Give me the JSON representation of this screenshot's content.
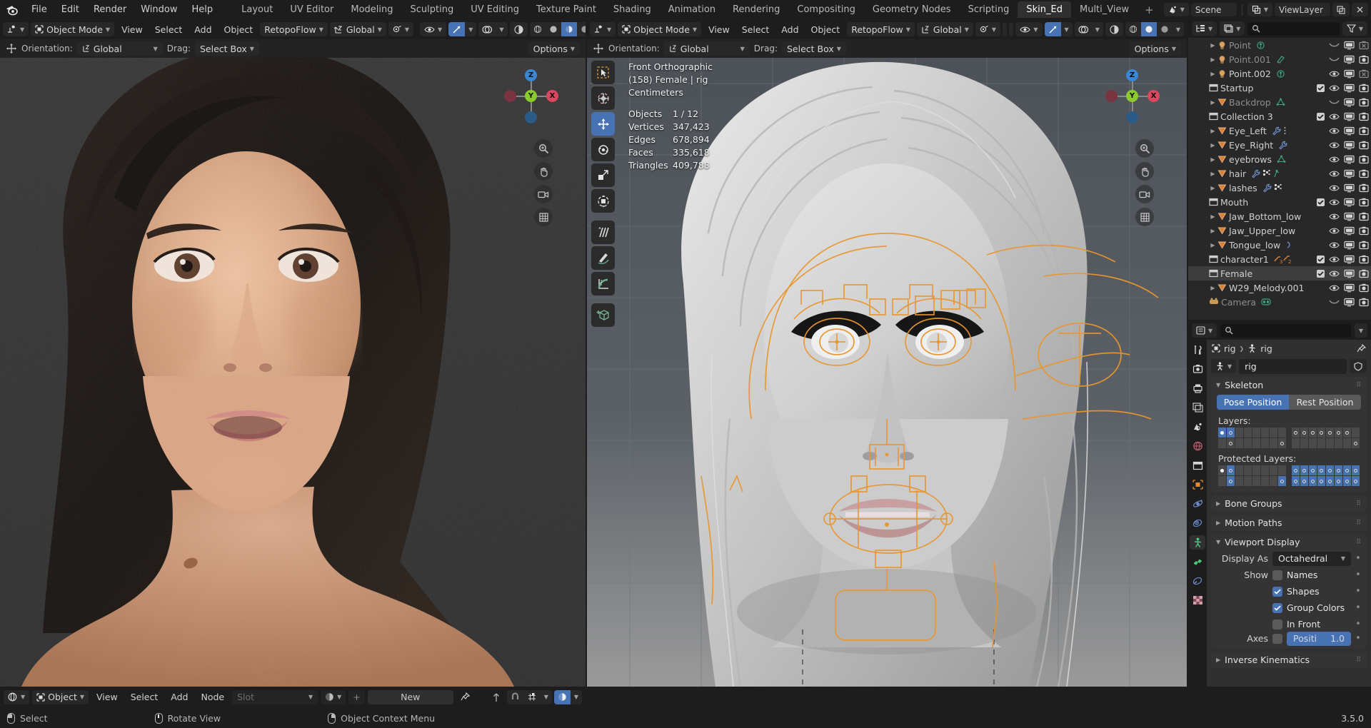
{
  "app": {
    "version": "3.5.0",
    "logo_icon": "blender-logo-icon"
  },
  "topbar": {
    "menus": [
      "File",
      "Edit",
      "Render",
      "Window",
      "Help"
    ],
    "workspace_tabs": [
      {
        "label": "Layout",
        "active": false
      },
      {
        "label": "UV Editor",
        "active": false
      },
      {
        "label": "Modeling",
        "active": false
      },
      {
        "label": "Sculpting",
        "active": false
      },
      {
        "label": "UV Editing",
        "active": false
      },
      {
        "label": "Texture Paint",
        "active": false
      },
      {
        "label": "Shading",
        "active": false
      },
      {
        "label": "Animation",
        "active": false
      },
      {
        "label": "Rendering",
        "active": false
      },
      {
        "label": "Compositing",
        "active": false
      },
      {
        "label": "Geometry Nodes",
        "active": false
      },
      {
        "label": "Scripting",
        "active": false
      },
      {
        "label": "Skin_Ed",
        "active": true
      },
      {
        "label": "Multi_View",
        "active": false
      }
    ],
    "add_workspace_label": "+",
    "scene_label": "Scene",
    "scene_icon": "scene-icon",
    "viewlayer_label": "ViewLayer",
    "viewlayer_icon": "viewlayer-icon",
    "new_viewlayer_icon": "copy-icon",
    "remove_viewlayer_icon": "x-icon"
  },
  "viewport1": {
    "editor_icon": "editor-type-icon",
    "mode_label": "Object Mode",
    "mode_icon": "object-mode-icon",
    "menus": [
      "View",
      "Select",
      "Add",
      "Object"
    ],
    "addon_menu": "RetopoFlow",
    "transform_orientation": "Global",
    "orientation_icon": "orientation-icon",
    "snap_icon": "magnet-icon",
    "snap_to_icon": "snap-increment-icon",
    "proportional_icon": "proportional-edit-icon",
    "falloff_icon": "falloff-smooth-icon",
    "visibility_icon": "eye-icon",
    "gizmo_icon": "gizmo-icon",
    "overlay_icon": "overlays-icon",
    "xray_icon": "xray-icon",
    "shading_icon": "shading-rendered-icon",
    "options_label": "Options",
    "subheader": {
      "orientation_label": "Orientation:",
      "orientation_value": "Global",
      "drag_label": "Drag:",
      "drag_value": "Select Box"
    }
  },
  "viewport2": {
    "editor_icon": "editor-type-icon",
    "mode_label": "Object Mode",
    "mode_icon": "object-mode-icon",
    "menus": [
      "View",
      "Select",
      "Add",
      "Object"
    ],
    "addon_menu": "RetopoFlow",
    "transform_orientation": "Global",
    "options_label": "Options",
    "subheader": {
      "orientation_label": "Orientation:",
      "orientation_value": "Global",
      "drag_label": "Drag:",
      "drag_value": "Select Box"
    },
    "gizmo": {
      "x": "X",
      "y": "Y",
      "z": "Z"
    },
    "toolbar": [
      {
        "name": "tweak-tool",
        "active": false
      },
      {
        "name": "cursor-tool",
        "active": false
      },
      {
        "name": "move-tool",
        "active": true
      },
      {
        "name": "rotate-tool",
        "active": false
      },
      {
        "name": "scale-tool",
        "active": false
      },
      {
        "name": "transform-tool",
        "active": false
      },
      {
        "name": "annotate-tool",
        "active": false
      },
      {
        "name": "annotate-line-tool",
        "active": false
      },
      {
        "name": "measure-tool",
        "active": false
      },
      {
        "name": "add-cube-tool",
        "active": false
      }
    ],
    "stats": {
      "view_name": "Front Orthographic",
      "object_line": "(158) Female | rig",
      "units": "Centimeters",
      "rows": [
        {
          "label": "Objects",
          "value": "1 / 12"
        },
        {
          "label": "Vertices",
          "value": "347,423"
        },
        {
          "label": "Edges",
          "value": "678,894"
        },
        {
          "label": "Faces",
          "value": "335,618"
        },
        {
          "label": "Triangles",
          "value": "409,788"
        }
      ]
    }
  },
  "outliner": {
    "display_mode_icon": "outliner-view-layer-icon",
    "filter_id_icon": "filter-id-icon",
    "search_placeholder": "",
    "search_icon": "search-icon",
    "filter_icon": "filter-funnel-icon",
    "rows": [
      {
        "name": "Point",
        "type": "light",
        "indent": 2,
        "dim": true,
        "disclosure": true,
        "data_icon": "light-point-icon",
        "checkbox": null,
        "eye": "closed",
        "screen": true,
        "camera": "disabled"
      },
      {
        "name": "Point.001",
        "type": "light",
        "indent": 2,
        "dim": true,
        "disclosure": true,
        "data_icon": "light-area-icon",
        "checkbox": null,
        "eye": "closed",
        "screen": true,
        "camera": "on"
      },
      {
        "name": "Point.002",
        "type": "light",
        "indent": 2,
        "dim": false,
        "disclosure": true,
        "data_icon": "light-point-icon",
        "checkbox": null,
        "eye": "open",
        "screen": true,
        "camera": "disabled"
      },
      {
        "name": "Startup",
        "type": "collection",
        "indent": 1,
        "dim": false,
        "disclosure": false,
        "data_icon": null,
        "checkbox": true,
        "eye": "open",
        "screen": true,
        "camera": "on"
      },
      {
        "name": "Backdrop",
        "type": "mesh",
        "indent": 2,
        "dim": true,
        "disclosure": true,
        "data_icon": "mesh-data-icon",
        "checkbox": null,
        "eye": "closed",
        "screen": true,
        "camera": "on"
      },
      {
        "name": "Collection 3",
        "type": "collection",
        "indent": 1,
        "dim": false,
        "disclosure": false,
        "data_icon": null,
        "checkbox": true,
        "eye": "open",
        "screen": true,
        "camera": "on"
      },
      {
        "name": "Eye_Left",
        "type": "mesh",
        "indent": 2,
        "dim": false,
        "disclosure": true,
        "data_icon": "modifier-wrench-icon",
        "extra_icon": "dots-icon",
        "checkbox": null,
        "eye": "open",
        "screen": true,
        "camera": "on"
      },
      {
        "name": "Eye_Right",
        "type": "mesh",
        "indent": 2,
        "dim": false,
        "disclosure": true,
        "data_icon": "modifier-wrench-icon",
        "checkbox": null,
        "eye": "open",
        "screen": true,
        "camera": "on"
      },
      {
        "name": "eyebrows",
        "type": "mesh",
        "indent": 2,
        "dim": false,
        "disclosure": true,
        "data_icon": "mesh-data-icon",
        "checkbox": null,
        "eye": "open",
        "screen": true,
        "camera": "on"
      },
      {
        "name": "hair",
        "type": "mesh",
        "indent": 2,
        "dim": false,
        "disclosure": true,
        "data_icon": "modifier-wrench-icon",
        "extra_icon": "particles-icon",
        "extra_icon2": "vertex-group-icon",
        "checkbox": null,
        "eye": "open",
        "screen": true,
        "camera": "on"
      },
      {
        "name": "lashes",
        "type": "mesh",
        "indent": 2,
        "dim": false,
        "disclosure": true,
        "data_icon": "modifier-wrench-icon",
        "extra_icon": "particles-icon",
        "checkbox": null,
        "eye": "open",
        "screen": true,
        "camera": "on"
      },
      {
        "name": "Mouth",
        "type": "collection",
        "indent": 1,
        "dim": false,
        "disclosure": false,
        "data_icon": null,
        "checkbox": true,
        "eye": "open",
        "screen": true,
        "camera": "on"
      },
      {
        "name": "Jaw_Bottom_low",
        "type": "mesh",
        "indent": 2,
        "dim": false,
        "disclosure": true,
        "data_icon": null,
        "checkbox": null,
        "eye": "open",
        "screen": true,
        "camera": "on"
      },
      {
        "name": "Jaw_Upper_low",
        "type": "mesh",
        "indent": 2,
        "dim": false,
        "disclosure": true,
        "data_icon": null,
        "checkbox": null,
        "eye": "open",
        "screen": true,
        "camera": "on"
      },
      {
        "name": "Tongue_low",
        "type": "mesh",
        "indent": 2,
        "dim": false,
        "disclosure": true,
        "data_icon": "curve-icon",
        "checkbox": null,
        "eye": "open",
        "screen": true,
        "camera": "on"
      },
      {
        "name": "character1",
        "type": "collection",
        "indent": 1,
        "dim": false,
        "disclosure": false,
        "data_icon": "armature-pair-icon",
        "checkbox": true,
        "eye": "open",
        "screen": true,
        "camera": "on"
      },
      {
        "name": "Female",
        "type": "collection",
        "indent": 1,
        "dim": false,
        "disclosure": false,
        "selected": true,
        "data_icon": null,
        "checkbox": true,
        "eye": "open",
        "screen": true,
        "camera": "on"
      },
      {
        "name": "W29_Melody.001",
        "type": "mesh",
        "indent": 2,
        "dim": false,
        "disclosure": true,
        "data_icon": null,
        "checkbox": null,
        "eye": "open",
        "screen": true,
        "camera": "on"
      },
      {
        "name": "Camera",
        "type": "camera",
        "indent": 1,
        "dim": true,
        "disclosure": false,
        "data_icon": "camera-data-icon",
        "checkbox": null,
        "eye": "closed",
        "screen": true,
        "camera": "on"
      }
    ]
  },
  "properties": {
    "editor_icon": "properties-editor-icon",
    "search_placeholder": "",
    "search_icon": "search-icon",
    "options_icon": "chevron-down-icon",
    "tabs": [
      {
        "name": "tool-tab",
        "icon": "tool-screwdriver-wrench-icon",
        "active": false
      },
      {
        "name": "render-tab",
        "icon": "render-camera-back-icon",
        "active": false
      },
      {
        "name": "output-tab",
        "icon": "output-printer-icon",
        "active": false
      },
      {
        "name": "viewlayer-tab",
        "icon": "view-layer-images-icon",
        "active": false
      },
      {
        "name": "scene-tab",
        "icon": "scene-cone-icon",
        "active": false
      },
      {
        "name": "world-tab",
        "icon": "world-globe-icon",
        "active": false
      },
      {
        "name": "collection-tab",
        "icon": "collection-box-icon",
        "active": false
      },
      {
        "name": "object-tab",
        "icon": "object-square-icon",
        "active": false
      },
      {
        "name": "modifier-tab",
        "icon": "physics-orbit-icon",
        "active": false
      },
      {
        "name": "constraint-tab",
        "icon": "constraint-icon",
        "active": false
      },
      {
        "name": "data-tab",
        "icon": "armature-data-icon",
        "active": true
      },
      {
        "name": "bone-tab",
        "icon": "bone-icon",
        "active": false
      },
      {
        "name": "bone-constraint-tab",
        "icon": "bone-constraint-icon",
        "active": false
      },
      {
        "name": "texture-tab",
        "icon": "texture-checker-icon",
        "active": false
      }
    ],
    "breadcrumb": [
      {
        "label": "rig",
        "icon": "object-square-icon"
      },
      {
        "label": "rig",
        "icon": "armature-data-icon"
      }
    ],
    "pin_icon": "pin-icon",
    "id_name": "rig",
    "id_icon": "armature-data-icon",
    "shield_icon": "shield-icon",
    "panels": {
      "skeleton": {
        "title": "Skeleton",
        "expanded": true,
        "pose_position_label": "Pose Position",
        "rest_position_label": "Rest Position",
        "pose_active": true,
        "layers_label": "Layers:",
        "protected_layers_label": "Protected Layers:",
        "layers_left": [
          [
            true,
            true,
            false,
            false,
            false,
            false,
            false,
            false
          ],
          [
            false,
            true,
            false,
            false,
            false,
            false,
            false,
            true
          ]
        ],
        "layers_left_filled": [
          true,
          false,
          false,
          false,
          false,
          false,
          false,
          false
        ],
        "layers_right": [
          [
            true,
            true,
            true,
            true,
            true,
            true,
            true,
            false
          ],
          [
            false,
            false,
            false,
            false,
            false,
            false,
            false,
            true
          ]
        ],
        "protected_left": [
          [
            true,
            true,
            false,
            false,
            false,
            false,
            false,
            false
          ],
          [
            false,
            true,
            false,
            false,
            false,
            false,
            false,
            true
          ]
        ],
        "protected_right_on": [
          [
            true,
            true,
            true,
            true,
            true,
            true,
            true,
            true
          ],
          [
            true,
            true,
            true,
            true,
            true,
            true,
            true,
            true
          ]
        ]
      },
      "bone_groups": {
        "title": "Bone Groups",
        "expanded": false
      },
      "motion_paths": {
        "title": "Motion Paths",
        "expanded": false
      },
      "viewport_display": {
        "title": "Viewport Display",
        "expanded": true,
        "display_as_label": "Display As",
        "display_as_value": "Octahedral",
        "show_label": "Show",
        "names_label": "Names",
        "names_checked": false,
        "shapes_label": "Shapes",
        "shapes_checked": true,
        "group_colors_label": "Group Colors",
        "group_colors_checked": true,
        "in_front_label": "In Front",
        "in_front_checked": false,
        "axes_label": "Axes",
        "axes_checked": false,
        "axes_position_label": "Positi",
        "axes_position_value": "1.0"
      },
      "inverse_kinematics": {
        "title": "Inverse Kinematics",
        "expanded": false
      }
    }
  },
  "shader_editor": {
    "editor_icon": "shader-editor-icon",
    "shader_type_label": "Object",
    "shader_type_icon": "object-mode-icon",
    "menus": [
      "View",
      "Select",
      "Add",
      "Node"
    ],
    "slot_label": "Slot",
    "material_icon": "material-sphere-icon",
    "add_label": "+",
    "new_label": "New",
    "pin_icon": "pin-icon",
    "up_icon": "arrow-up-icon",
    "snap_icon": "snap-magnet-icon",
    "snap_node_icon": "snap-node-icon",
    "shading_icon": "material-preview-icon"
  },
  "statusbar": {
    "items": [
      {
        "label": "Select",
        "mouse": "left"
      },
      {
        "label": "Rotate View",
        "mouse": "middle"
      },
      {
        "label": "Object Context Menu",
        "mouse": "right"
      }
    ],
    "version": "3.5.0"
  },
  "colors": {
    "accent_blue": "#4772b3",
    "bg_dark": "#1d1d1d",
    "bg_panel": "#303030",
    "bg_field": "#282828",
    "rig_orange": "#e89b3b",
    "axis_x": "#d9485f",
    "axis_y": "#8bcb2e",
    "axis_z": "#3b87d4",
    "text": "#e5e5e5"
  }
}
